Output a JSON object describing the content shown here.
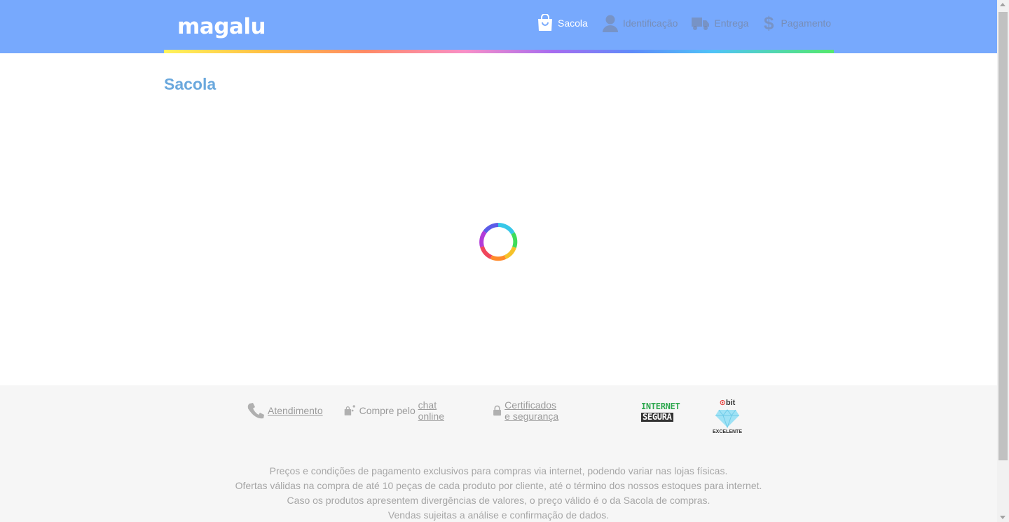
{
  "header": {
    "logo": "magalu",
    "steps": [
      {
        "label": "Sacola",
        "icon": "shopping-bag-icon",
        "active": true
      },
      {
        "label": "Identificação",
        "icon": "user-icon",
        "active": false
      },
      {
        "label": "Entrega",
        "icon": "truck-icon",
        "active": false
      },
      {
        "label": "Pagamento",
        "icon": "dollar-icon",
        "active": false
      }
    ]
  },
  "main": {
    "title": "Sacola",
    "loading": true
  },
  "footer": {
    "links": [
      {
        "icon": "phone-icon",
        "text": "Atendimento"
      },
      {
        "icon": "chat-bag-icon",
        "prefix": "Compre pelo ",
        "text": "chat online"
      },
      {
        "icon": "lock-icon",
        "text": "Certificados e segurança"
      }
    ],
    "badges": {
      "internet_segura": {
        "line1": "INTERNET",
        "line2": "SEGURA"
      },
      "ebit": {
        "brand": "ebit",
        "rating": "EXCELENTE"
      }
    },
    "legal": [
      "Preços e condições de pagamento exclusivos para compras via internet, podendo variar nas lojas físicas.",
      "Ofertas válidas na compra de até 10 peças de cada produto por cliente, até o término dos nossos estoques para internet.",
      "Caso os produtos apresentem divergências de valores, o preço válido é o da Sacola de compras.",
      "Vendas sujeitas a análise e confirmação de dados."
    ]
  },
  "colors": {
    "header_bg": "#77a9fd",
    "title": "#6aa8dd",
    "footer_bg": "#f6f6f6",
    "footer_text": "#9b9b9b"
  }
}
